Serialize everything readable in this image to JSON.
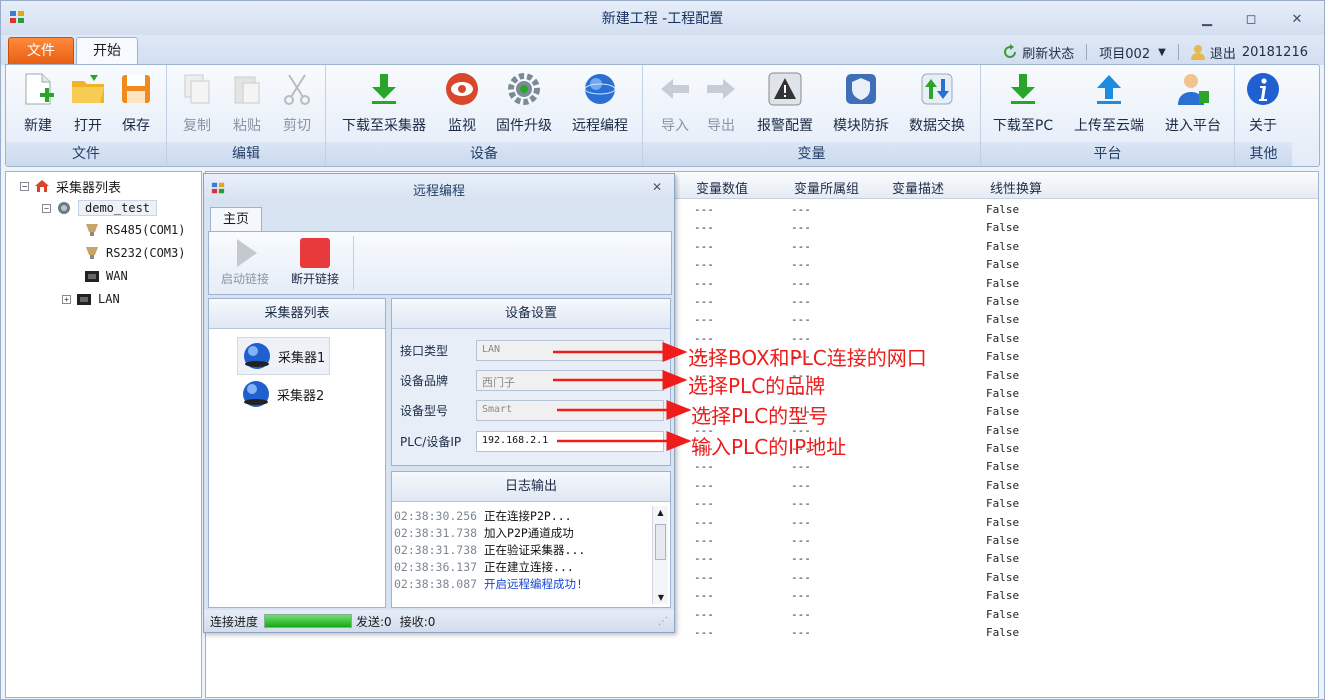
{
  "window": {
    "title": "新建工程 -工程配置"
  },
  "tabs": {
    "file": "文件",
    "home": "开始"
  },
  "header": {
    "refresh": "刷新状态",
    "project": "项目002",
    "logout": "退出",
    "date": "20181216"
  },
  "ribbon": {
    "groups": [
      "文件",
      "编辑",
      "设备",
      "变量",
      "平台",
      "其他"
    ],
    "buttons": {
      "new": "新建",
      "open": "打开",
      "save": "保存",
      "copy": "复制",
      "paste": "粘贴",
      "cut": "剪切",
      "download_collector": "下载至采集器",
      "monitor": "监视",
      "firmware": "固件升级",
      "remote": "远程编程",
      "import": "导入",
      "export": "导出",
      "alarm": "报警配置",
      "module": "模块防拆",
      "exchange": "数据交换",
      "download_pc": "下载至PC",
      "upload_cloud": "上传至云端",
      "enter_platform": "进入平台",
      "about": "关于"
    }
  },
  "tree": {
    "root": "采集器列表",
    "device": "demo_test",
    "items": [
      "RS485(COM1)",
      "RS232(COM3)",
      "WAN",
      "LAN"
    ]
  },
  "table": {
    "headers": [
      "变量数值",
      "变量所属组",
      "变量描述",
      "线性换算"
    ],
    "rows": [
      [
        "---",
        "---",
        "",
        "False"
      ],
      [
        "---",
        "---",
        "",
        "False"
      ],
      [
        "---",
        "---",
        "",
        "False"
      ],
      [
        "---",
        "---",
        "",
        "False"
      ],
      [
        "---",
        "---",
        "",
        "False"
      ],
      [
        "---",
        "---",
        "",
        "False"
      ],
      [
        "---",
        "---",
        "",
        "False"
      ],
      [
        "---",
        "---",
        "",
        "False"
      ],
      [
        "---",
        "---",
        "",
        "False"
      ],
      [
        "---",
        "---",
        "",
        "False"
      ],
      [
        "---",
        "---",
        "",
        "False"
      ],
      [
        "---",
        "---",
        "",
        "False"
      ],
      [
        "---",
        "---",
        "",
        "False"
      ],
      [
        "---",
        "---",
        "",
        "False"
      ],
      [
        "---",
        "---",
        "",
        "False"
      ],
      [
        "---",
        "---",
        "",
        "False"
      ],
      [
        "---",
        "---",
        "",
        "False"
      ],
      [
        "---",
        "---",
        "",
        "False"
      ],
      [
        "---",
        "---",
        "",
        "False"
      ],
      [
        "---",
        "---",
        "",
        "False"
      ],
      [
        "---",
        "---",
        "",
        "False"
      ],
      [
        "---",
        "---",
        "",
        "False"
      ],
      [
        "---",
        "---",
        "",
        "False"
      ],
      [
        "---",
        "---",
        "",
        "False"
      ]
    ]
  },
  "dialog": {
    "title": "远程编程",
    "tab": "主页",
    "start": "启动链接",
    "stop": "断开链接",
    "collector_header": "采集器列表",
    "collectors": [
      "采集器1",
      "采集器2"
    ],
    "settings_header": "设备设置",
    "fields": [
      {
        "label": "接口类型",
        "value": "LAN"
      },
      {
        "label": "设备品牌",
        "value": "西门子"
      },
      {
        "label": "设备型号",
        "value": "Smart"
      },
      {
        "label": "PLC/设备IP",
        "value": "192.168.2.1"
      }
    ],
    "log_header": "日志输出",
    "log": [
      {
        "time": "02:38:30.256",
        "msg": "正在连接P2P..."
      },
      {
        "time": "02:38:31.738",
        "msg": "加入P2P通道成功"
      },
      {
        "time": "02:38:31.738",
        "msg": "正在验证采集器..."
      },
      {
        "time": "02:38:36.137",
        "msg": "正在建立连接..."
      },
      {
        "time": "02:38:38.087",
        "msg": "开启远程编程成功!"
      }
    ],
    "status": {
      "progress_label": "连接进度",
      "progress": 1.0,
      "sent": "发送:0",
      "received": "接收:0"
    }
  },
  "annotations": [
    "选择BOX和PLC连接的网口",
    "选择PLC的品牌",
    "选择PLC的型号",
    "输入PLC的IP地址"
  ],
  "colors": {
    "accent_orange": "#e85c10",
    "annotation_red": "#ef1c1c",
    "progress_green": "#18a818",
    "log_success_blue": "#1646d8"
  }
}
